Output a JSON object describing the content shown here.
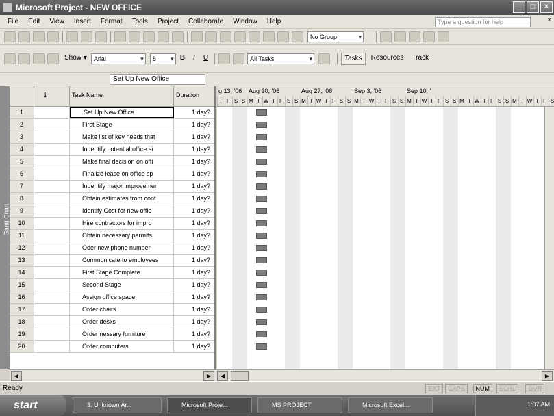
{
  "window": {
    "title": "Microsoft Project - NEW OFFICE",
    "min": "_",
    "max": "□",
    "close": "×"
  },
  "menu": {
    "items": [
      "File",
      "Edit",
      "View",
      "Insert",
      "Format",
      "Tools",
      "Project",
      "Collaborate",
      "Window",
      "Help"
    ],
    "help_placeholder": "Type a question for help",
    "close_label": "×"
  },
  "toolbar1": {
    "group_select": "No Group"
  },
  "toolbar2": {
    "show_label": "Show ▾",
    "font_name": "Arial",
    "font_size": "8",
    "bold": "B",
    "italic": "I",
    "underline": "U",
    "filter": "All Tasks",
    "tasks_button": "Tasks",
    "resources_button": "Resources",
    "track_button": "Track"
  },
  "entry_bar": {
    "value": "Set Up New Office"
  },
  "view_bar": {
    "label": "Gantt Chart"
  },
  "grid": {
    "columns": {
      "id": "",
      "indicator": "ℹ",
      "name": "Task Name",
      "duration": "Duration"
    },
    "rows": [
      {
        "id": "1",
        "name": "Set Up New Office",
        "duration": "1 day?"
      },
      {
        "id": "2",
        "name": "First Stage",
        "duration": "1 day?"
      },
      {
        "id": "3",
        "name": "Make list of key needs that",
        "duration": "1 day?"
      },
      {
        "id": "4",
        "name": "Indentify potential office si",
        "duration": "1 day?"
      },
      {
        "id": "5",
        "name": "Make final decision on offi",
        "duration": "1 day?"
      },
      {
        "id": "6",
        "name": "Finalize lease on office sp",
        "duration": "1 day?"
      },
      {
        "id": "7",
        "name": "Indentify major improvemer",
        "duration": "1 day?"
      },
      {
        "id": "8",
        "name": "Obtain estimates from cont",
        "duration": "1 day?"
      },
      {
        "id": "9",
        "name": "Identify Cost for new offic",
        "duration": "1 day?"
      },
      {
        "id": "10",
        "name": "Hire contractors for impro",
        "duration": "1 day?"
      },
      {
        "id": "11",
        "name": "Obtain necessary permits",
        "duration": "1 day?"
      },
      {
        "id": "12",
        "name": "Oder new phone number",
        "duration": "1 day?"
      },
      {
        "id": "13",
        "name": "Communicate to employees",
        "duration": "1 day?"
      },
      {
        "id": "14",
        "name": "First Stage Complete",
        "duration": "1 day?"
      },
      {
        "id": "15",
        "name": "Second Stage",
        "duration": "1 day?"
      },
      {
        "id": "16",
        "name": "Assign office space",
        "duration": "1 day?"
      },
      {
        "id": "17",
        "name": "Order chairs",
        "duration": "1 day?"
      },
      {
        "id": "18",
        "name": "Order desks",
        "duration": "1 day?"
      },
      {
        "id": "19",
        "name": "Order nessary furniture",
        "duration": "1 day?"
      },
      {
        "id": "20",
        "name": "Order computers",
        "duration": "1 day?"
      }
    ]
  },
  "gantt": {
    "weeks": [
      "g 13, '06",
      "Aug 20, '06",
      "Aug 27, '06",
      "Sep 3, '06",
      "Sep 10, '"
    ],
    "days": [
      "M",
      "T",
      "W",
      "T",
      "F",
      "S",
      "S"
    ]
  },
  "status": {
    "text": "Ready",
    "indicators": [
      "EXT",
      "CAPS",
      "NUM",
      "SCRL",
      "OVR"
    ],
    "active": "NUM"
  },
  "taskbar": {
    "start": "start",
    "tasks": [
      "3. Unknown Ar...",
      "Microsoft Proje...",
      "MS PROJECT",
      "Microsoft Excel..."
    ],
    "clock": "1:07 AM"
  }
}
